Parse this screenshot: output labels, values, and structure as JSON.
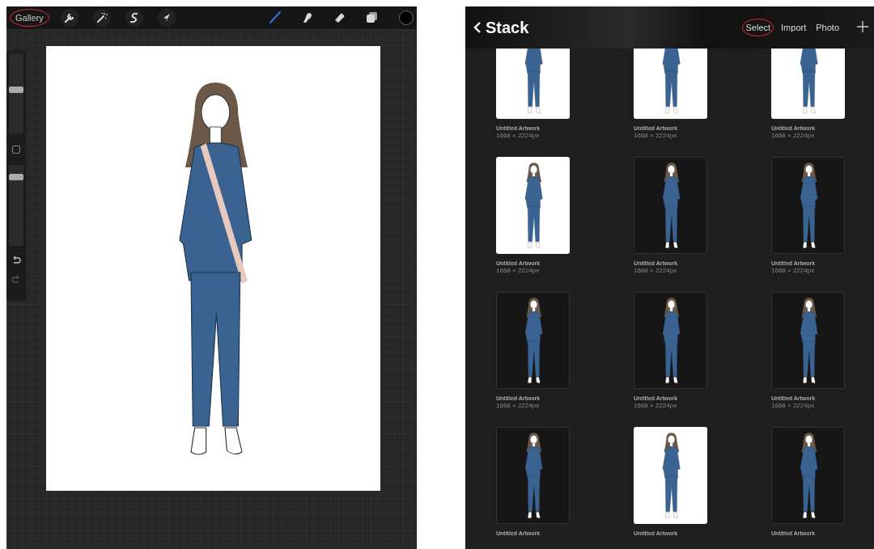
{
  "canvas_screen": {
    "gallery_button": {
      "label": "Gallery",
      "highlighted": true
    },
    "left_tools": [
      {
        "kind": "wrench"
      },
      {
        "kind": "wand"
      },
      {
        "kind": "selection"
      },
      {
        "kind": "arrow"
      }
    ],
    "right_tools": [
      {
        "kind": "brush",
        "selected": true
      },
      {
        "kind": "smudge",
        "selected": false
      },
      {
        "kind": "eraser",
        "selected": false
      },
      {
        "kind": "layers",
        "selected": false
      }
    ],
    "color_swatch": {
      "color": "#000000"
    },
    "side_bar": {
      "brush_size": {
        "level": 0.55
      },
      "opacity": {
        "level": 0.85
      }
    }
  },
  "gallery_screen": {
    "back_title": "Stack",
    "actions": [
      {
        "kind": "text",
        "label": "Select",
        "highlighted": true
      },
      {
        "kind": "text",
        "label": "Import",
        "highlighted": false
      },
      {
        "kind": "text",
        "label": "Photo",
        "highlighted": false
      },
      {
        "kind": "add"
      }
    ],
    "artworks": [
      {
        "title": "Untitled Artwork",
        "size": "1668 × 2224px",
        "dark": false
      },
      {
        "title": "Untitled Artwork",
        "size": "1668 × 2224px",
        "dark": false
      },
      {
        "title": "Untitled Artwork",
        "size": "1668 × 2224px",
        "dark": false
      },
      {
        "title": "Untitled Artwork",
        "size": "1668 × 2224px",
        "dark": false
      },
      {
        "title": "Untitled Artwork",
        "size": "1668 × 2224px",
        "dark": true
      },
      {
        "title": "Untitled Artwork",
        "size": "1668 × 2224px",
        "dark": true
      },
      {
        "title": "Untitled Artwork",
        "size": "1668 × 2224px",
        "dark": true
      },
      {
        "title": "Untitled Artwork",
        "size": "1668 × 2224px",
        "dark": true
      },
      {
        "title": "Untitled Artwork",
        "size": "1668 × 2224px",
        "dark": true
      },
      {
        "title": "Untitled Artwork",
        "dark": true
      },
      {
        "title": "Untitled Artwork",
        "dark": false
      },
      {
        "title": "Untitled Artwork",
        "dark": true
      }
    ]
  }
}
